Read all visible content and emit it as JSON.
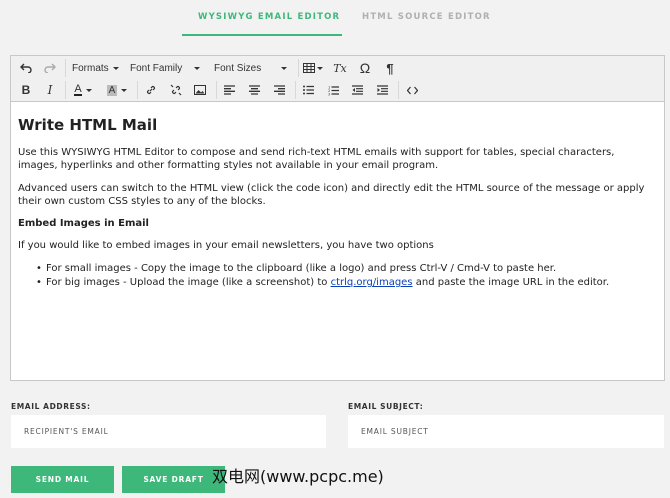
{
  "tabs": {
    "wysiwyg": "WYSIWYG EMAIL EDITOR",
    "source": "HTML SOURCE EDITOR"
  },
  "toolbar": {
    "formats": "Formats",
    "font_family": "Font Family",
    "font_sizes": "Font Sizes",
    "omega": "Ω",
    "bold": "B",
    "italic": "I",
    "text_color_letter": "A",
    "bg_color_letter": "A",
    "clear_format": "Tx",
    "code": "<>"
  },
  "content": {
    "heading": "Write HTML Mail",
    "p1": "Use this WYSIWYG HTML Editor to compose and send rich-text HTML emails with support for tables, special characters, images, hyperlinks and other formatting styles not available in your email program.",
    "p2": "Advanced users can switch to the HTML view (click the code icon) and directly edit the HTML source of the message or apply their own custom CSS styles to any of the blocks.",
    "subheading": "Embed Images in Email",
    "p3": "If you would like to embed images in your email newsletters, you have two options",
    "bullet1": "For small images - Copy the image to the clipboard (like a logo) and press Ctrl-V / Cmd-V to paste her.",
    "bullet2_pre": "For big images - Upload the image (like a screenshot) to ",
    "bullet2_link": "ctrlq.org/images",
    "bullet2_post": " and paste the image URL in the editor."
  },
  "form": {
    "email_label": "EMAIL ADDRESS:",
    "email_placeholder": "RECIPIENT'S EMAIL",
    "subject_label": "EMAIL SUBJECT:",
    "subject_placeholder": "EMAIL SUBJECT",
    "send_label": "SEND MAIL",
    "draft_label": "SAVE DRAFT"
  },
  "watermark": "双电网(www.pcpc.me)",
  "colors": {
    "accent": "#3db87a",
    "link": "#0b3fb8"
  }
}
